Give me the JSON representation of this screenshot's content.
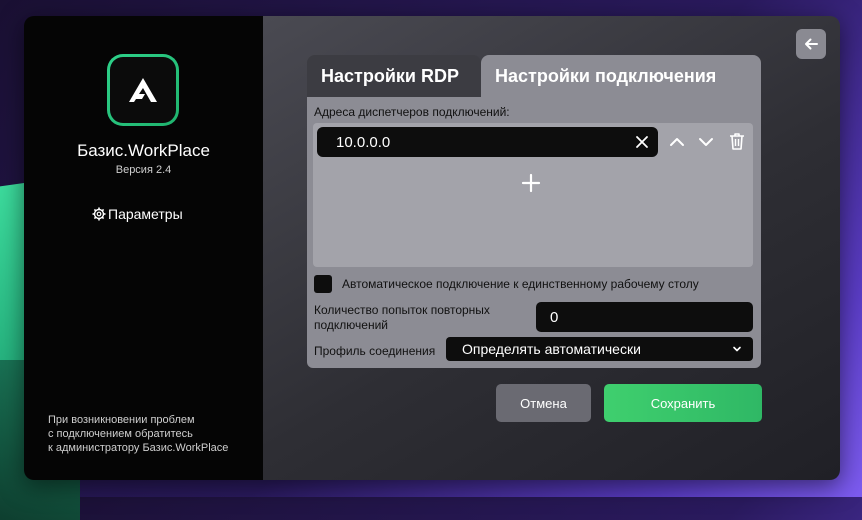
{
  "app": {
    "title": "Базис.WorkPlace",
    "version": "Версия 2.4",
    "params_label": "Параметры",
    "help_lines": [
      "При возникновении проблем",
      "с подключением обратитесь",
      "к администратору Базис.WorkPlace"
    ]
  },
  "tabs": [
    {
      "label": "Настройки RDP",
      "active": false
    },
    {
      "label": "Настройки подключения",
      "active": true
    }
  ],
  "connection": {
    "brokers_label": "Адреса диспетчеров подключений:",
    "brokers": [
      "10.0.0.0"
    ],
    "auto_connect_label": "Автоматическое подключение к единственному рабочему столу",
    "auto_connect_checked": false,
    "retries_label_line1": "Количество попыток повторных",
    "retries_label_line2": "подключений",
    "retries_value": "0",
    "profile_label": "Профиль соединения",
    "profile_value": "Определять автоматически"
  },
  "actions": {
    "cancel_label": "Отмена",
    "save_label": "Сохранить"
  },
  "colors": {
    "accent_green": "#3fcf6e",
    "panel_bg": "#8c8c94"
  }
}
